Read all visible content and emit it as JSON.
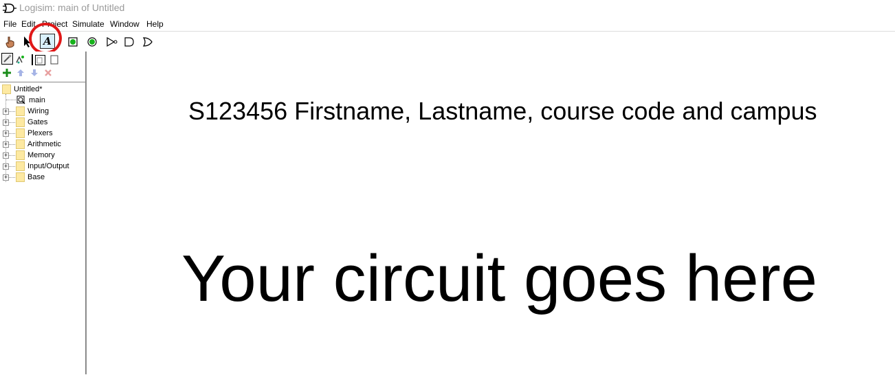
{
  "window": {
    "title": "Logisim: main of Untitled"
  },
  "menubar": {
    "items": [
      "File",
      "Edit",
      "Project",
      "Simulate",
      "Window",
      "Help"
    ]
  },
  "toolbar": {
    "tools": [
      "poke-tool",
      "edit-tool",
      "text-tool",
      "input-pin",
      "output-pin",
      "not-gate",
      "and-gate",
      "or-gate"
    ],
    "text_tool_label": "A",
    "highlight_color": "#e01818"
  },
  "explorer": {
    "project": "Untitled*",
    "circuit": "main",
    "libraries": [
      "Wiring",
      "Gates",
      "Plexers",
      "Arithmetic",
      "Memory",
      "Input/Output",
      "Base"
    ]
  },
  "canvas": {
    "header": "S123456 Firstname, Lastname, course code and campus",
    "placeholder": "Your circuit goes here"
  }
}
